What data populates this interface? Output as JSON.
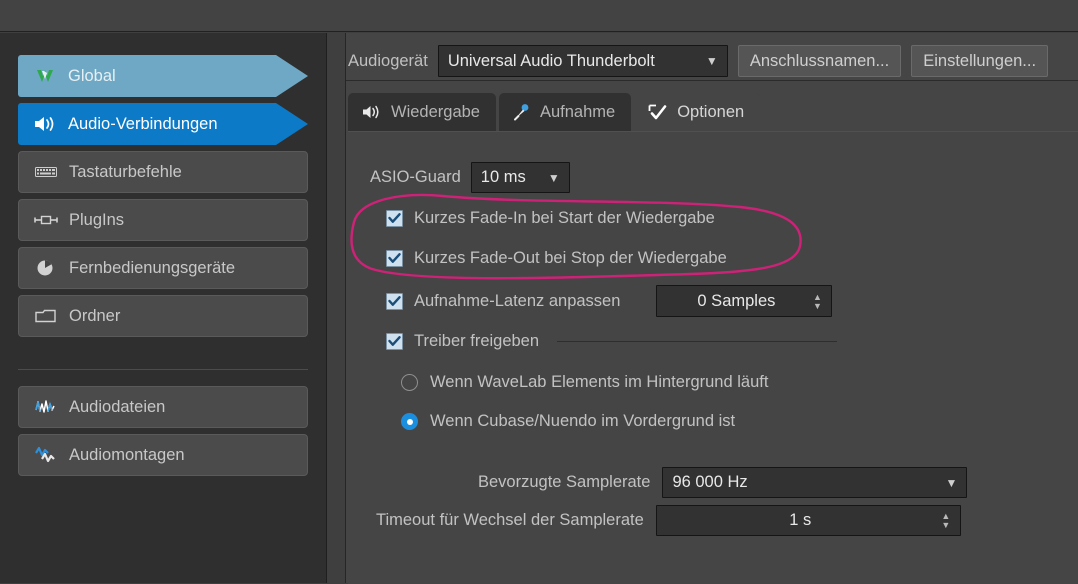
{
  "sidebar": {
    "items": [
      {
        "label": "Global",
        "icon": "wavelab-logo-icon",
        "state": "selected-soft"
      },
      {
        "label": "Audio-Verbindungen",
        "icon": "speaker-icon",
        "state": "selected-strong"
      },
      {
        "label": "Tastaturbefehle",
        "icon": "keyboard-icon",
        "state": "normal"
      },
      {
        "label": "PlugIns",
        "icon": "plugin-icon",
        "state": "normal"
      },
      {
        "label": "Fernbedienungsgeräte",
        "icon": "remote-device-icon",
        "state": "normal"
      },
      {
        "label": "Ordner",
        "icon": "folder-icon",
        "state": "normal"
      }
    ],
    "items2": [
      {
        "label": "Audiodateien",
        "icon": "waveform-icon",
        "state": "normal"
      },
      {
        "label": "Audiomontagen",
        "icon": "montage-icon",
        "state": "normal"
      }
    ]
  },
  "header": {
    "device_label": "Audiogerät",
    "device_value": "Universal Audio Thunderbolt",
    "port_names_button": "Anschlussnamen...",
    "settings_button": "Einstellungen..."
  },
  "tabs": [
    {
      "label": "Wiedergabe",
      "icon": "speaker-icon",
      "active": false
    },
    {
      "label": "Aufnahme",
      "icon": "microphone-icon",
      "active": false
    },
    {
      "label": "Optionen",
      "icon": "options-check-icon",
      "active": true
    }
  ],
  "options": {
    "asio_guard_label": "ASIO-Guard",
    "asio_guard_value": "10 ms",
    "fade_in_label": "Kurzes Fade-In bei Start der Wiedergabe",
    "fade_in_checked": true,
    "fade_out_label": "Kurzes Fade-Out bei Stop der Wiedergabe",
    "fade_out_checked": true,
    "rec_latency_label": "Aufnahme-Latenz anpassen",
    "rec_latency_checked": true,
    "rec_latency_value": "0 Samples",
    "release_driver_label": "Treiber freigeben",
    "release_driver_checked": true,
    "radio_background_label": "Wenn WaveLab Elements im Hintergrund läuft",
    "radio_background_selected": false,
    "radio_foreground_label": "Wenn Cubase/Nuendo im Vordergrund ist",
    "radio_foreground_selected": true,
    "preferred_samplerate_label": "Bevorzugte Samplerate",
    "preferred_samplerate_value": "96 000 Hz",
    "samplerate_timeout_label": "Timeout für Wechsel der Samplerate",
    "samplerate_timeout_value": "1 s"
  },
  "annotation": {
    "type": "hand-drawn-ellipse",
    "color": "#cc2277",
    "encircles": [
      "Kurzes Fade-In bei Start der Wiedergabe",
      "Kurzes Fade-Out bei Stop der Wiedergabe"
    ]
  },
  "colors": {
    "accent_blue": "#0c7ac6",
    "soft_blue": "#6fa8c4",
    "panel_bg": "#454545",
    "sidebar_bg": "#2f2f2f",
    "annotation_pink": "#cc2277"
  }
}
